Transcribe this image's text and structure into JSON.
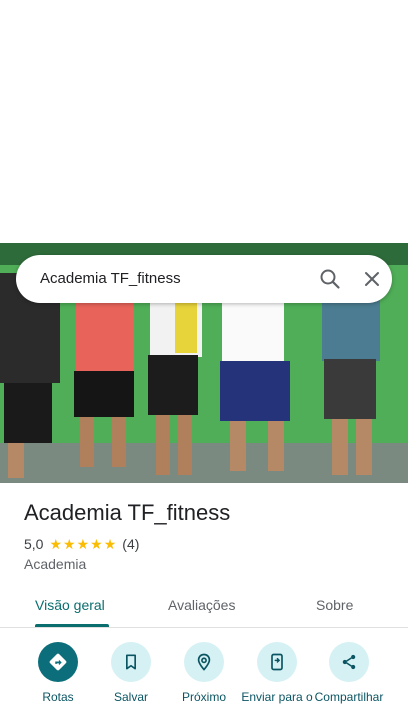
{
  "search": {
    "query": "Academia TF_fitness"
  },
  "place": {
    "title": "Academia TF_fitness",
    "rating": "5,0",
    "stars": 5,
    "review_count": "(4)",
    "category": "Academia"
  },
  "tabs": [
    {
      "label": "Visão geral",
      "active": true
    },
    {
      "label": "Avaliações",
      "active": false
    },
    {
      "label": "Sobre",
      "active": false
    }
  ],
  "actions": [
    {
      "label": "Rotas",
      "icon": "directions-icon"
    },
    {
      "label": "Salvar",
      "icon": "bookmark-icon"
    },
    {
      "label": "Próximo",
      "icon": "nearby-icon"
    },
    {
      "label": "Enviar para o",
      "icon": "send-to-phone-icon"
    },
    {
      "label": "Compartilhar",
      "icon": "share-icon"
    }
  ],
  "colors": {
    "accent": "#0b6e6e",
    "action_bg": "#d5f1f4",
    "primary_action_bg": "#0b6e7a",
    "star": "#fbbc04"
  }
}
